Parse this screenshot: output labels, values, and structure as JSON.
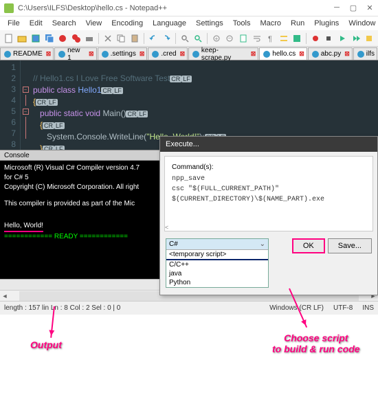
{
  "window": {
    "title": "C:\\Users\\ILFS\\Desktop\\hello.cs - Notepad++"
  },
  "menu": [
    "File",
    "Edit",
    "Search",
    "View",
    "Encoding",
    "Language",
    "Settings",
    "Tools",
    "Macro",
    "Run",
    "Plugins",
    "Window",
    "?"
  ],
  "tabs": [
    {
      "label": "README",
      "x": "⊠"
    },
    {
      "label": "new 1",
      "x": "⊠"
    },
    {
      "label": ".settings",
      "x": "⊠"
    },
    {
      "label": ".cred",
      "x": "⊠"
    },
    {
      "label": "keep-scrape.py",
      "x": "⊠"
    },
    {
      "label": "hello.cs",
      "x": "⊠",
      "active": true
    },
    {
      "label": "abc.py",
      "x": "⊠"
    },
    {
      "label": "ilfs",
      "x": ""
    }
  ],
  "gutter": [
    "1",
    "2",
    "3",
    "4",
    "5",
    "6",
    "7",
    "8"
  ],
  "code": {
    "l1_cmt": "// Hello1.cs I Love Free Software Test",
    "l2_kw1": "public",
    "l2_kw2": "class",
    "l2_cls": "Hello1",
    "l4_kw1": "public",
    "l4_kw2": "static",
    "l4_kw3": "void",
    "l4_fn": "Main()",
    "l6_call": "System.Console.WriteLine(",
    "l6_str": "\"Hello, World!\"",
    "l6_end": ");",
    "cr": "CR",
    "lf": "LF"
  },
  "console_header": "Console",
  "console": {
    "l1": "Microsoft (R) Visual C# Compiler version 4.7",
    "l2": "for C# 5",
    "l3": "Copyright (C) Microsoft Corporation. All right",
    "l4": "This compiler is provided as part of the Mic",
    "hello": "Hello, World!",
    "ready": "============ READY ============"
  },
  "dialog": {
    "title": "Execute...",
    "cmds_label": "Command(s):",
    "cmd1": "npp_save",
    "cmd2": "csc \"$(FULL_CURRENT_PATH)\"",
    "cmd3": "$(CURRENT_DIRECTORY)\\$(NAME_PART).exe",
    "scroll_l": "<",
    "select_value": "C#",
    "options": [
      "<temporary script>",
      "",
      "C/C++",
      "java",
      "Python"
    ],
    "ok": "OK",
    "save": "Save..."
  },
  "status": {
    "len": "length : 157    lin Ln : 8    Col : 2    Sel : 0 | 0",
    "eol": "Windows (CR LF)",
    "enc": "UTF-8",
    "ins": "INS"
  },
  "anno": {
    "output": "Output",
    "choose": "Choose script\nto build & run code"
  }
}
